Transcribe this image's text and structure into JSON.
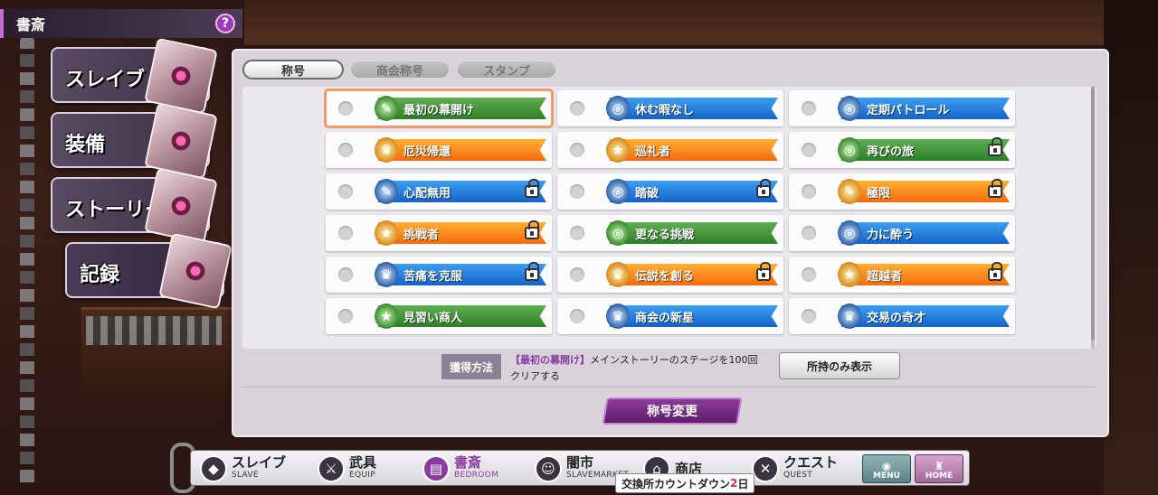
{
  "window": {
    "title": "書斎",
    "help_icon": "?"
  },
  "side_menu": [
    {
      "label": "スレイブ",
      "active": false
    },
    {
      "label": "装備",
      "active": false
    },
    {
      "label": "ストーリー",
      "active": false
    },
    {
      "label": "記録",
      "active": true
    }
  ],
  "tabs": [
    {
      "label": "称号",
      "active": true
    },
    {
      "label": "商会称号",
      "active": false
    },
    {
      "label": "スタンプ",
      "active": false
    }
  ],
  "titles": [
    {
      "name": "最初の幕開け",
      "color": "green",
      "locked": false,
      "selected": true,
      "icon": "scroll-icon"
    },
    {
      "name": "休む暇なし",
      "color": "blue",
      "locked": false,
      "selected": false,
      "icon": "ring-icon"
    },
    {
      "name": "定期パトロール",
      "color": "blue",
      "locked": false,
      "selected": false,
      "icon": "ring-icon"
    },
    {
      "name": "厄災帰還",
      "color": "orange",
      "locked": false,
      "selected": false,
      "icon": "trophy-icon"
    },
    {
      "name": "巡礼者",
      "color": "orange",
      "locked": false,
      "selected": false,
      "icon": "star-icon"
    },
    {
      "name": "再びの旅",
      "color": "green",
      "locked": true,
      "selected": false,
      "icon": "ring-icon"
    },
    {
      "name": "心配無用",
      "color": "blue",
      "locked": true,
      "selected": false,
      "icon": "scroll-icon"
    },
    {
      "name": "踏破",
      "color": "blue",
      "locked": true,
      "selected": false,
      "icon": "ring-icon"
    },
    {
      "name": "極限",
      "color": "orange",
      "locked": true,
      "selected": false,
      "icon": "scroll-icon"
    },
    {
      "name": "挑戦者",
      "color": "orange",
      "locked": true,
      "selected": false,
      "icon": "star-icon"
    },
    {
      "name": "更なる挑戦",
      "color": "green",
      "locked": false,
      "selected": false,
      "icon": "ring-icon"
    },
    {
      "name": "力に酔う",
      "color": "blue",
      "locked": false,
      "selected": false,
      "icon": "ring-icon"
    },
    {
      "name": "苦痛を克服",
      "color": "blue",
      "locked": true,
      "selected": false,
      "icon": "trophy-icon"
    },
    {
      "name": "伝説を創る",
      "color": "orange",
      "locked": true,
      "selected": false,
      "icon": "trophy-icon"
    },
    {
      "name": "超越者",
      "color": "orange",
      "locked": true,
      "selected": false,
      "icon": "star-icon"
    },
    {
      "name": "見習い商人",
      "color": "green",
      "locked": false,
      "selected": false,
      "icon": "star-icon"
    },
    {
      "name": "商会の新星",
      "color": "blue",
      "locked": false,
      "selected": false,
      "icon": "trophy-icon"
    },
    {
      "name": "交易の奇才",
      "color": "blue",
      "locked": false,
      "selected": false,
      "icon": "trophy-icon"
    }
  ],
  "acquisition": {
    "label": "獲得方法",
    "title_ref": "【最初の幕開け】",
    "text_line1": "メインストーリーのステージを100回",
    "text_line2": "クリアする"
  },
  "owned_only_button": "所持のみ表示",
  "change_title_button": "称号変更",
  "bottom_nav": [
    {
      "jp": "スレイブ",
      "en": "SLAVE",
      "active": false,
      "icon": "shield-icon"
    },
    {
      "jp": "武具",
      "en": "EQUIP",
      "active": false,
      "icon": "sword-icon"
    },
    {
      "jp": "書斎",
      "en": "BEDROOM",
      "active": true,
      "icon": "book-icon"
    },
    {
      "jp": "闇市",
      "en": "SLAVEMARKET",
      "active": false,
      "icon": "mask-icon"
    },
    {
      "jp": "商店",
      "en": "",
      "active": false,
      "icon": "shop-icon"
    },
    {
      "jp": "クエスト",
      "en": "QUEST",
      "active": false,
      "icon": "crossed-swords-icon"
    }
  ],
  "menu_button": "MENU",
  "home_button": "HOME",
  "countdown": {
    "prefix": "交換所カウントダウン",
    "days": "2",
    "suffix": "日"
  },
  "colors": {
    "accent": "#8b3aa0",
    "green": "#3c8a31",
    "blue": "#1463c9",
    "orange": "#f46a10",
    "selected_outline": "#f29a6c"
  }
}
